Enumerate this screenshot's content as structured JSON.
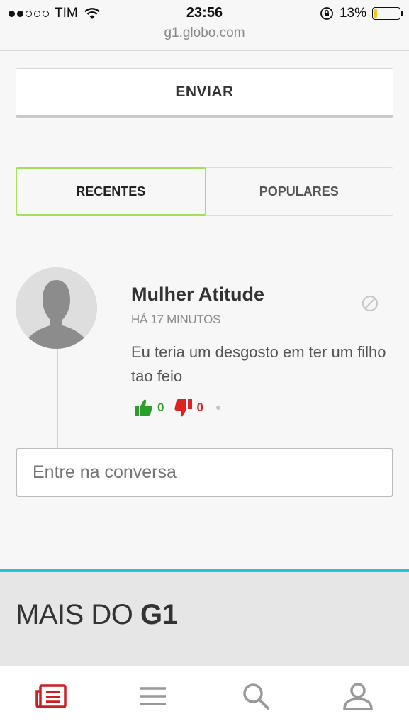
{
  "status_bar": {
    "carrier": "TIM",
    "time": "23:56",
    "battery": "13%",
    "battery_level": 0.13
  },
  "url": "g1.globo.com",
  "send_button": {
    "label": "ENVIAR"
  },
  "tabs": [
    {
      "label": "RECENTES",
      "active": true
    },
    {
      "label": "POPULARES",
      "active": false
    }
  ],
  "comment": {
    "author": "Mulher Atitude",
    "time": "HÁ 17 MINUTOS",
    "text": "Eu teria um desgosto em ter um filho tao feio",
    "likes": "0",
    "dislikes": "0"
  },
  "reply": {
    "placeholder": "Entre na conversa"
  },
  "more": {
    "prefix": "MAIS DO ",
    "brand": "G1"
  },
  "colors": {
    "accent_green": "#a2e05a",
    "like_green": "#2a9d2a",
    "dislike_red": "#dd2222",
    "section_border": "#26c1d4",
    "nav_active": "#cc1f1f"
  },
  "bottom_nav": [
    {
      "icon": "news-icon",
      "active": true
    },
    {
      "icon": "menu-icon",
      "active": false
    },
    {
      "icon": "search-icon",
      "active": false
    },
    {
      "icon": "user-icon",
      "active": false
    }
  ]
}
